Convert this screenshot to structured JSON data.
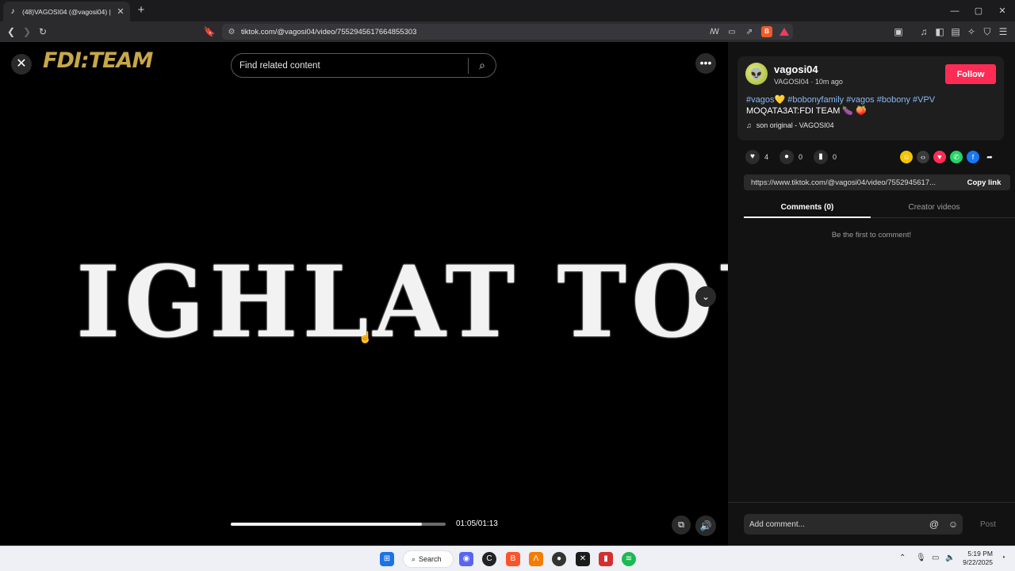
{
  "browser": {
    "tab_title": "(48)VAGOSI04 (@vagosi04) |",
    "new_tab_symbol": "+",
    "url": "tiktok.com/@vagosi04/video/7552945617664855303"
  },
  "video": {
    "logo_text": "FDI:TEAM",
    "search_placeholder": "Find related content",
    "overlay_text": "IGHLAT TOUT",
    "progress_fraction": 0.89,
    "time": "01:05/01:13"
  },
  "author": {
    "username": "vagosi04",
    "subline": "VAGOSI04 · 10m ago",
    "follow_label": "Follow",
    "hashtags": "#vagos💛 #bobonyfamily #vagos #bobony #VPV",
    "caption": "MOQATA3AT:FDI TEAM 🍆 🍑",
    "music": "son original - VAGOSI04"
  },
  "stats": {
    "likes": "4",
    "comments": "0",
    "saves": "0"
  },
  "share": {
    "link": "https://www.tiktok.com/@vagosi04/video/7552945617...",
    "copy_label": "Copy link"
  },
  "panel_tabs": {
    "comments": "Comments (0)",
    "creator": "Creator videos"
  },
  "comments": {
    "empty_text": "Be the first to comment!",
    "input_placeholder": "Add comment...",
    "post_label": "Post"
  },
  "taskbar": {
    "search_label": "Search",
    "time": "5:19 PM",
    "date": "9/22/2025"
  },
  "colors": {
    "accent": "#fe2c55",
    "hashtag": "#8ab8f5",
    "logo": "#c7a74a"
  }
}
